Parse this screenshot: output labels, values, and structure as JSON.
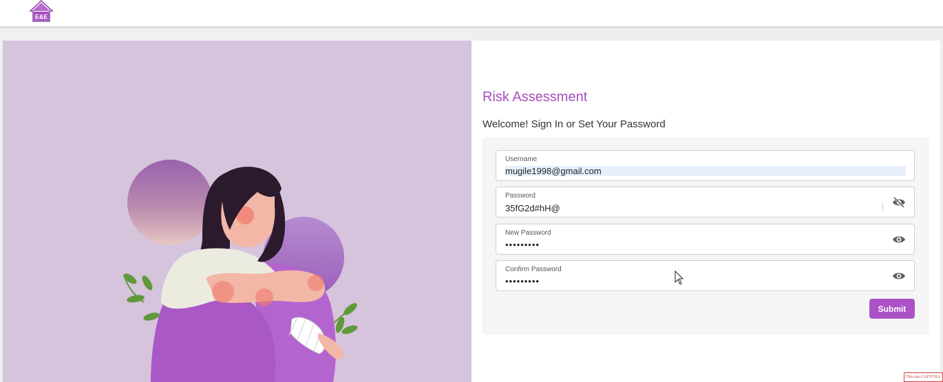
{
  "header": {
    "logo_icon": "house-logo-icon",
    "logo_text": "E&E"
  },
  "form": {
    "title": "Risk Assessment",
    "subtitle": "Welcome! Sign In or Set Your Password",
    "fields": [
      {
        "label": "Username",
        "value": "mugile1998@gmail.com",
        "type": "text"
      },
      {
        "label": "Password",
        "value": "35fG2d#hH@",
        "type": "text",
        "icon": "eye-slash-icon"
      },
      {
        "label": "New Password",
        "value": "•••••••••",
        "type": "password",
        "icon": "eye-icon"
      },
      {
        "label": "Confirm Password",
        "value": "•••••••••",
        "type": "password",
        "icon": "eye-icon"
      }
    ],
    "submit_label": "Submit"
  },
  "badge": {
    "text": "This site CAPTCHA"
  },
  "colors": {
    "accent": "#a64fbf",
    "button": "#ab52c6",
    "illustration_bg": "#d6c3dc"
  }
}
